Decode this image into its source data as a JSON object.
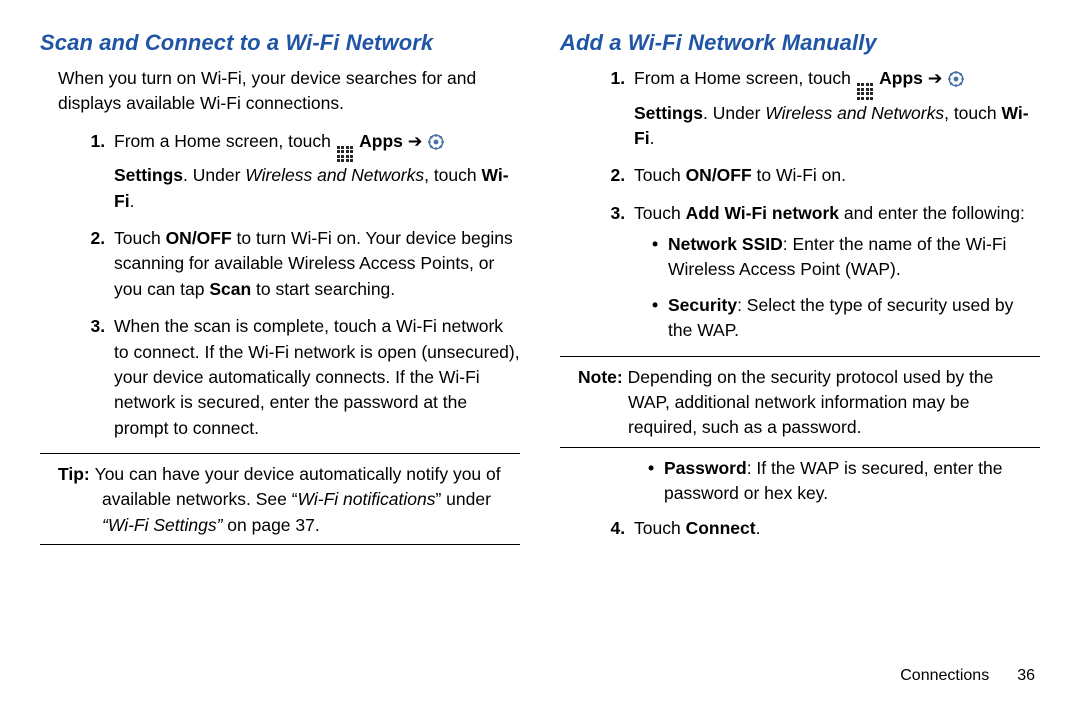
{
  "left": {
    "heading": "Scan and Connect to a Wi-Fi Network",
    "intro": "When you turn on Wi-Fi, your device searches for and displays available Wi-Fi connections.",
    "step1_a": "From a Home screen, touch ",
    "apps_label": "Apps",
    "arrow": " ➔ ",
    "settings_label": "Settings",
    "step1_b": ". Under ",
    "wireless_and_networks": "Wireless and Networks",
    "step1_c": ", touch ",
    "wifi_label": "Wi-Fi",
    "step1_d": ".",
    "step2_a": "Touch ",
    "onoff": "ON/OFF",
    "step2_b": " to turn Wi-Fi on. Your device begins scanning for available Wireless Access Points, or you can tap ",
    "scan": "Scan",
    "step2_c": " to start searching.",
    "step3": "When the scan is complete, touch a Wi-Fi network to connect. If the Wi-Fi network is open (unsecured), your device automatically connects. If the Wi-Fi network is secured, enter the password at the prompt to connect.",
    "tip_lead": "Tip: ",
    "tip_a": "You can have your device automatically notify you of available networks. See “",
    "tip_em": "Wi-Fi notifications",
    "tip_b": "”  under ",
    "tip_ref": "“Wi-Fi Settings”",
    "tip_c": " on page 37."
  },
  "right": {
    "heading": "Add a Wi-Fi Network Manually",
    "step1_a": "From a Home screen, touch ",
    "apps_label": "Apps",
    "arrow": " ➔ ",
    "settings_label": "Settings",
    "step1_b": ". Under ",
    "wireless_and_networks": "Wireless and Networks",
    "step1_c": ", touch ",
    "wifi_label": "Wi-Fi",
    "step1_d": ".",
    "step2_a": "Touch ",
    "onoff": "ON/OFF",
    "step2_b": " to Wi-Fi on.",
    "step3_a": "Touch ",
    "add_wifi": "Add Wi-Fi network",
    "step3_b": " and enter the following:",
    "ssid_lead": "Network SSID",
    "ssid_text": ": Enter the name of the Wi-Fi Wireless Access Point (WAP).",
    "sec_lead": "Security",
    "sec_text": ": Select the type of security used by the WAP.",
    "note_lead": "Note: ",
    "note_text": "Depending on the security protocol used by the WAP, additional network information may be required, such as a password.",
    "pw_lead": "Password",
    "pw_text": ": If the WAP is secured, enter the password or hex key.",
    "step4_a": "Touch ",
    "connect": "Connect",
    "step4_b": "."
  },
  "footer": {
    "section": "Connections",
    "page": "36"
  }
}
